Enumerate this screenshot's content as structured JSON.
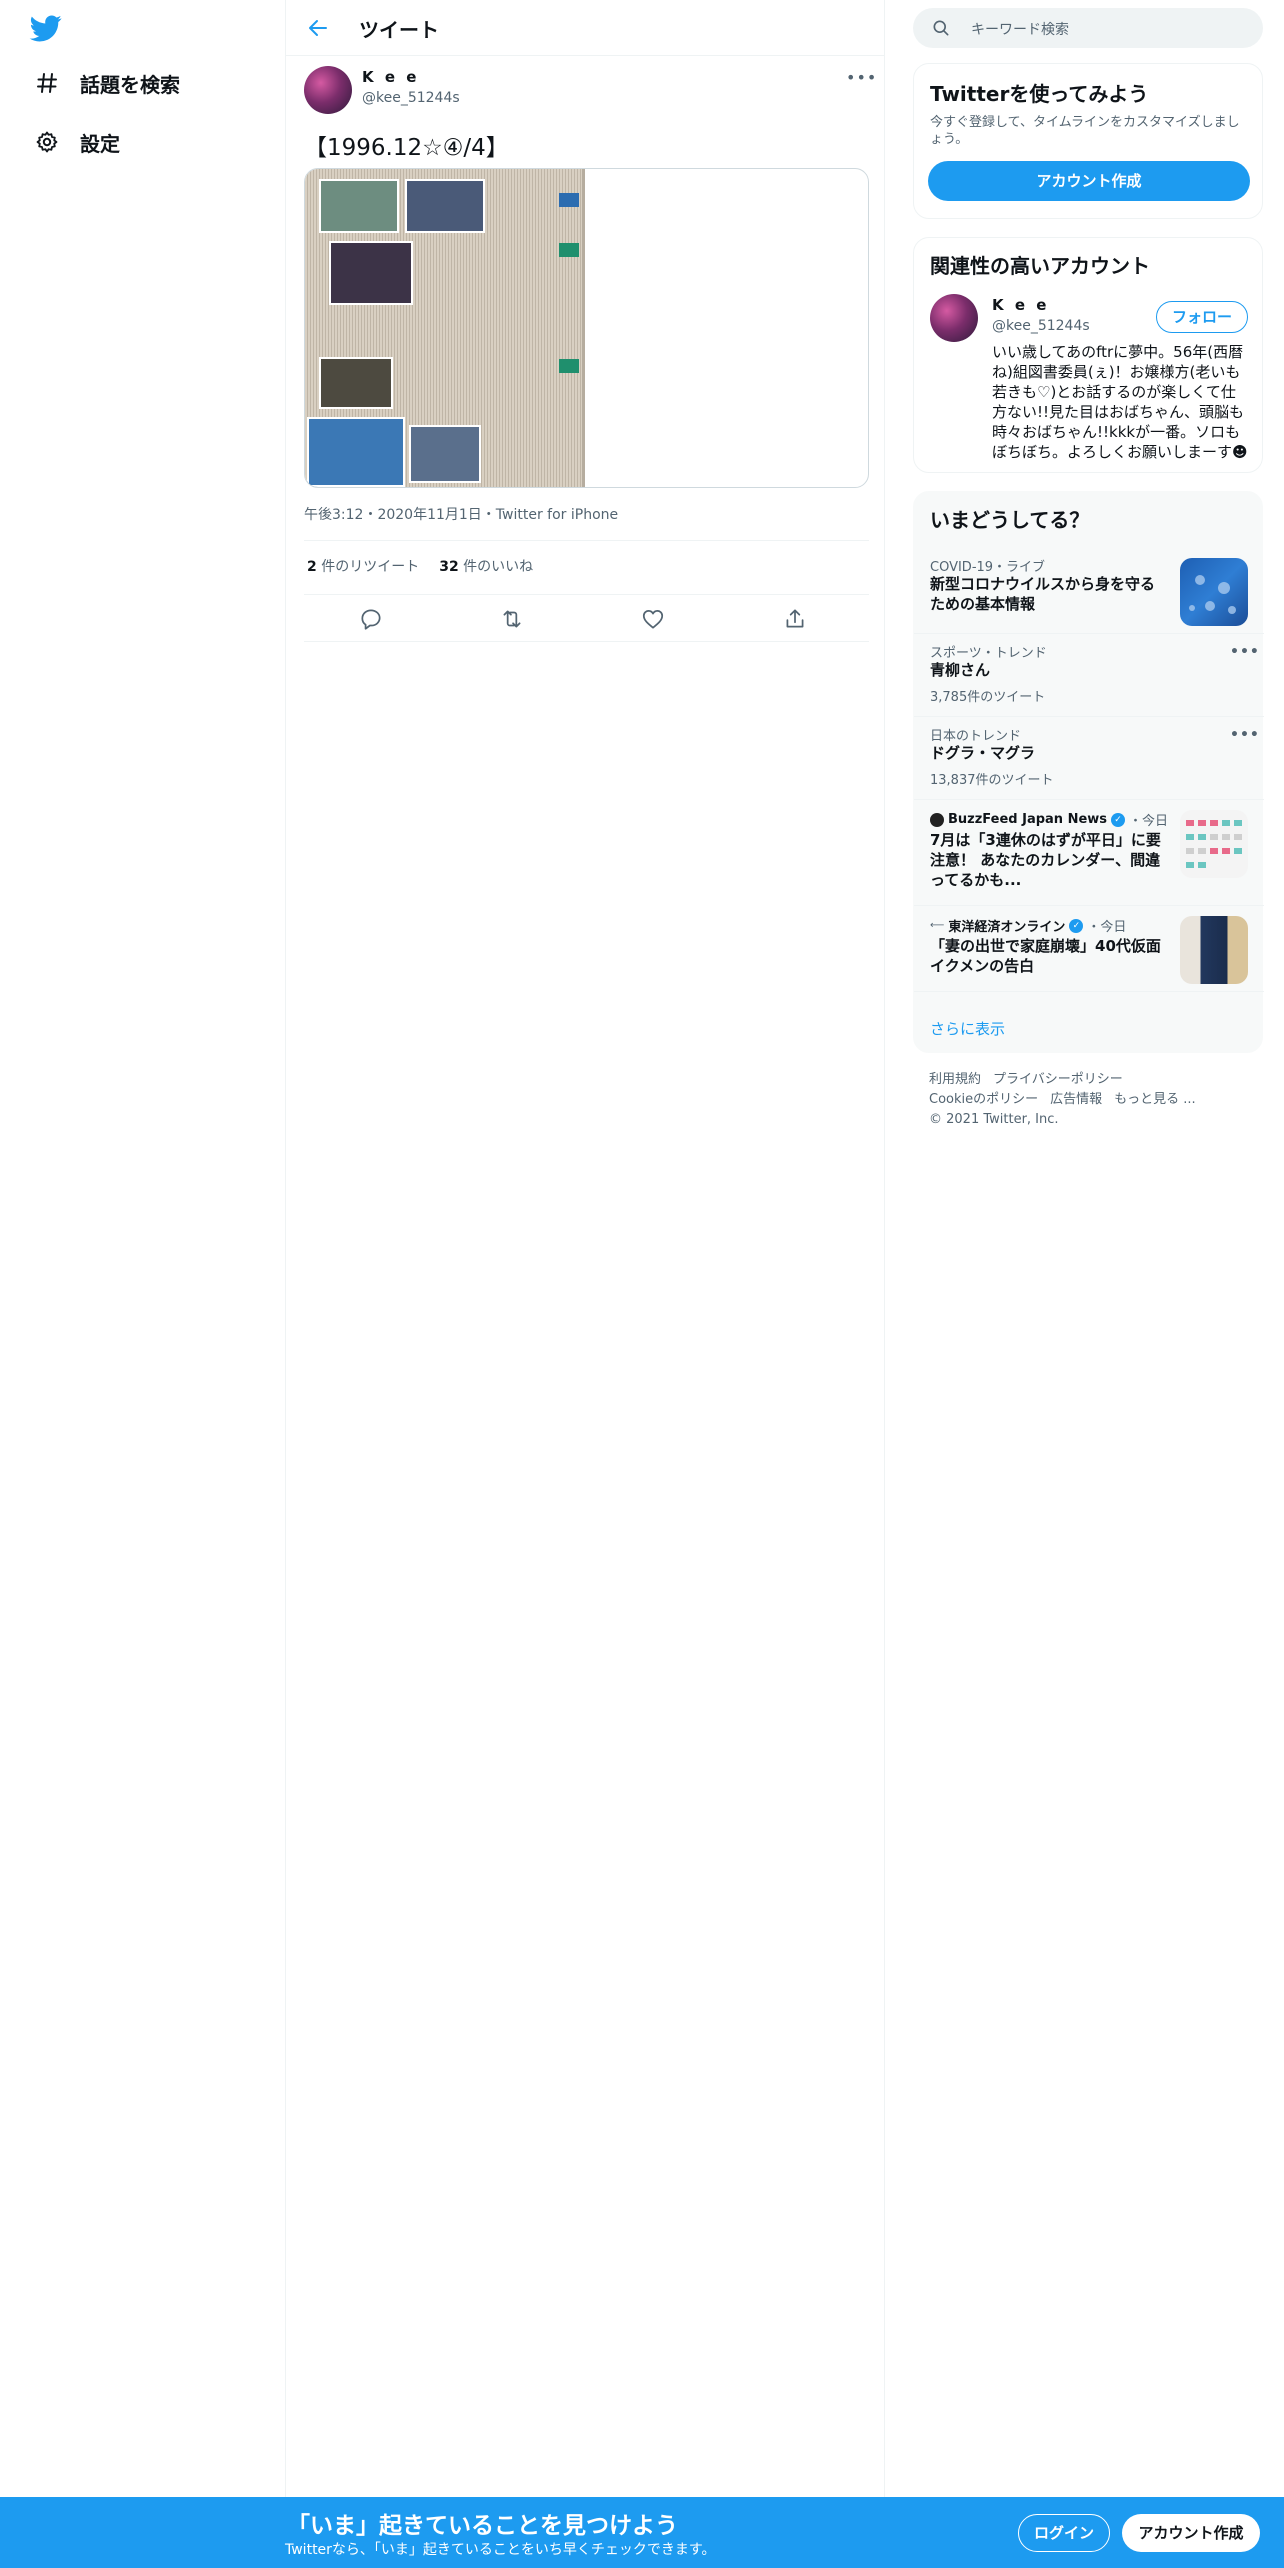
{
  "nav": {
    "items": [
      {
        "label": "話題を検索",
        "icon": "hashtag-icon"
      },
      {
        "label": "設定",
        "icon": "gear-icon"
      }
    ]
  },
  "header": {
    "title": "ツイート"
  },
  "tweet": {
    "name": "K e e",
    "handle": "@kee_51244s",
    "text": "【1996.12☆④/4】",
    "meta": "午後3:12・2020年11月1日・Twitter for iPhone",
    "retweets_count": "2",
    "retweets_label": "件のリツイート",
    "likes_count": "32",
    "likes_label": "件のいいね"
  },
  "search": {
    "placeholder": "キーワード検索"
  },
  "signup_card": {
    "title": "Twitterを使ってみよう",
    "subtitle": "今すぐ登録して、タイムラインをカスタマイズしましょう。",
    "button": "アカウント作成"
  },
  "related": {
    "title": "関連性の高いアカウント",
    "name": "K e e",
    "handle": "@kee_51244s",
    "follow": "フォロー",
    "bio": "いい歳してあのftrに夢中。56年(西暦ね)組図書委員(ぇ)！お嬢様方(老いも若きも♡)とお話するのが楽しくて仕方ない!!見た目はおばちゃん、頭脳も時々おばちゃん!!kkkが一番。ソロもぼちぼち。よろしくお願いしまーす☻"
  },
  "trends": {
    "title": "いまどうしてる？",
    "items": [
      {
        "meta": "COVID-19・ライブ",
        "title": "新型コロナウイルスから身を守るための基本情報"
      },
      {
        "meta": "スポーツ・トレンド",
        "title": "青柳さん",
        "count": "3,785件のツイート"
      },
      {
        "meta": "日本のトレンド",
        "title": "ドグラ・マグラ",
        "count": "13,837件のツイート"
      },
      {
        "source": "BuzzFeed Japan News",
        "when": "・今日",
        "title": "7月は「3連休のはずが平日」に要注意！ あなたのカレンダー、間違ってるかも..."
      },
      {
        "source": "東洋経済オンライン",
        "when": "・今日",
        "title": "「妻の出世で家庭崩壊」40代仮面イクメンの告白"
      }
    ],
    "show_more": "さらに表示"
  },
  "footer": {
    "links": [
      "利用規約",
      "プライバシーポリシー",
      "Cookieのポリシー",
      "広告情報",
      "もっと見る ..."
    ],
    "copyright": "© 2021 Twitter, Inc."
  },
  "bottom_bar": {
    "title": "「いま」起きていることを見つけよう",
    "subtitle": "Twitterなら、「いま」起きていることをいち早くチェックできます。",
    "login": "ログイン",
    "signup": "アカウント作成"
  },
  "colors": {
    "accent": "#1d9bf0",
    "text": "#0f1419",
    "muted": "#536471"
  }
}
